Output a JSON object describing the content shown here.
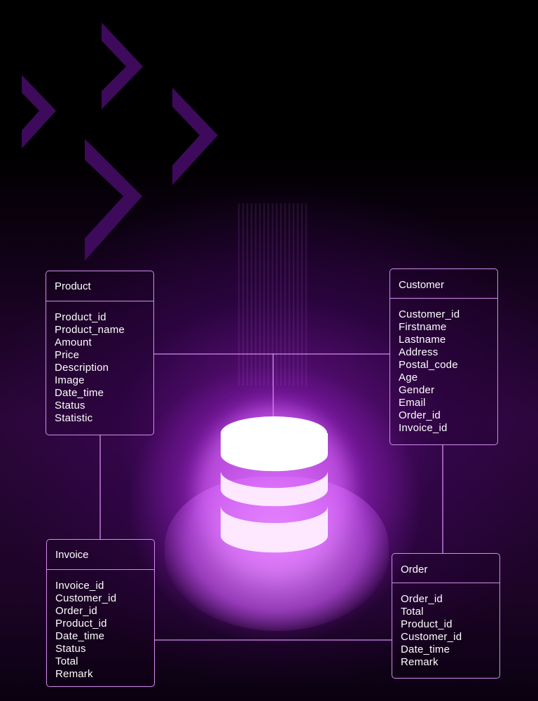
{
  "colors": {
    "accent": "#d58cf0",
    "chevron": "#3e0a5c",
    "glow": "#c050f0"
  },
  "icons": {
    "center": "database-icon",
    "decor": "chevron-right-icon"
  },
  "tables": [
    {
      "id": "product",
      "title": "Product",
      "fields": [
        "Product_id",
        "Product_name",
        "Amount",
        "Price",
        "Description",
        "Image",
        "Date_time",
        "Status",
        "Statistic"
      ]
    },
    {
      "id": "customer",
      "title": "Customer",
      "fields": [
        "Customer_id",
        "Firstname",
        "Lastname",
        "Address",
        "Postal_code",
        "Age",
        "Gender",
        "Email",
        "Order_id",
        "Invoice_id"
      ]
    },
    {
      "id": "invoice",
      "title": "Invoice",
      "fields": [
        "Invoice_id",
        "Customer_id",
        "Order_id",
        "Product_id",
        "Date_time",
        "Status",
        "Total",
        "Remark"
      ]
    },
    {
      "id": "order",
      "title": "Order",
      "fields": [
        "Order_id",
        "Total",
        "Product_id",
        "Customer_id",
        "Date_time",
        "Remark"
      ]
    }
  ]
}
